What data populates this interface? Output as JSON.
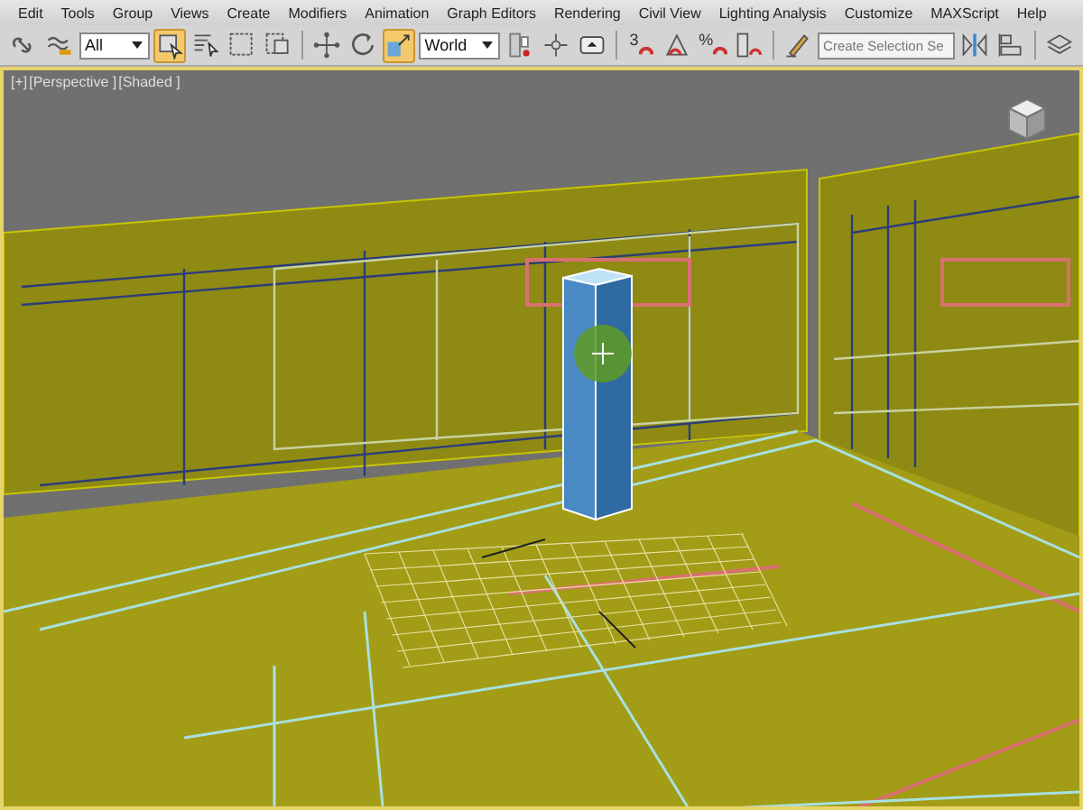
{
  "menu": [
    "Edit",
    "Tools",
    "Group",
    "Views",
    "Create",
    "Modifiers",
    "Animation",
    "Graph Editors",
    "Rendering",
    "Civil View",
    "Lighting Analysis",
    "Customize",
    "MAXScript",
    "Help"
  ],
  "toolbar": [
    {
      "kind": "button",
      "selected": false
    },
    {
      "kind": "button",
      "selected": false
    },
    {
      "kind": "dropdown",
      "value": "All"
    },
    {
      "kind": "button",
      "selected": true
    },
    {
      "kind": "button",
      "selected": false
    },
    {
      "kind": "button",
      "selected": false
    },
    {
      "kind": "button",
      "selected": false
    },
    {
      "kind": "separator"
    },
    {
      "kind": "button",
      "selected": false
    },
    {
      "kind": "button",
      "selected": false
    },
    {
      "kind": "button",
      "selected": true
    },
    {
      "kind": "dropdown",
      "value": "World"
    },
    {
      "kind": "button",
      "selected": false
    },
    {
      "kind": "button",
      "selected": false
    },
    {
      "kind": "button",
      "selected": false
    },
    {
      "kind": "separator"
    },
    {
      "kind": "snap",
      "label": "3"
    },
    {
      "kind": "button",
      "selected": false
    },
    {
      "kind": "snap",
      "label": "%"
    },
    {
      "kind": "button",
      "selected": false
    },
    {
      "kind": "separator"
    },
    {
      "kind": "button",
      "selected": false
    },
    {
      "kind": "field",
      "placeholder": "Create Selection Se"
    },
    {
      "kind": "button",
      "selected": false
    },
    {
      "kind": "button",
      "selected": false
    },
    {
      "kind": "separator"
    },
    {
      "kind": "button",
      "selected": false
    }
  ],
  "viewport": {
    "labels": [
      "[+]",
      "[Perspective ]",
      "[Shaded ]"
    ],
    "active": true
  }
}
